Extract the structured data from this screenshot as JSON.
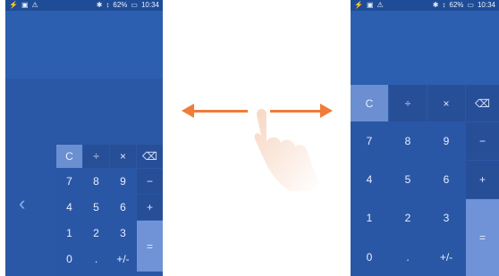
{
  "status_bar": {
    "left_icons": [
      "usb-icon",
      "image-icon",
      "warning-icon"
    ],
    "bluetooth": "✱",
    "signal": "↕",
    "battery": "62%",
    "battery_icon": "battery-icon",
    "time": "10:34"
  },
  "left_phone": {
    "nav_chevron": "‹",
    "keys_row1": [
      "C",
      "÷",
      "×",
      "⌫"
    ],
    "keys_row2": [
      "7",
      "8",
      "9",
      "−"
    ],
    "keys_row3": [
      "4",
      "5",
      "6",
      "+"
    ],
    "keys_row4": [
      "1",
      "2",
      "3"
    ],
    "keys_row5": [
      "0",
      ".",
      "+/-"
    ],
    "equals": "="
  },
  "right_phone": {
    "status_time_partial": "10:34",
    "keys_row1": [
      "C",
      "÷",
      "×",
      "⌫"
    ],
    "keys_row2": [
      "7",
      "8",
      "9",
      "−"
    ],
    "keys_row3": [
      "4",
      "5",
      "6",
      "+"
    ],
    "keys_row4": [
      "1",
      "2",
      "3"
    ],
    "keys_row5": [
      "0",
      ".",
      "+/-"
    ],
    "equals": "="
  },
  "gesture": {
    "arrow_color": "#f07c3a",
    "hand_color": "#f6d7c3"
  },
  "colors": {
    "calculator_bg": "#2b58a6",
    "status_bg": "#1f4c97",
    "c_key": "#6b8fd1",
    "equals_key": "#6f93d6"
  }
}
